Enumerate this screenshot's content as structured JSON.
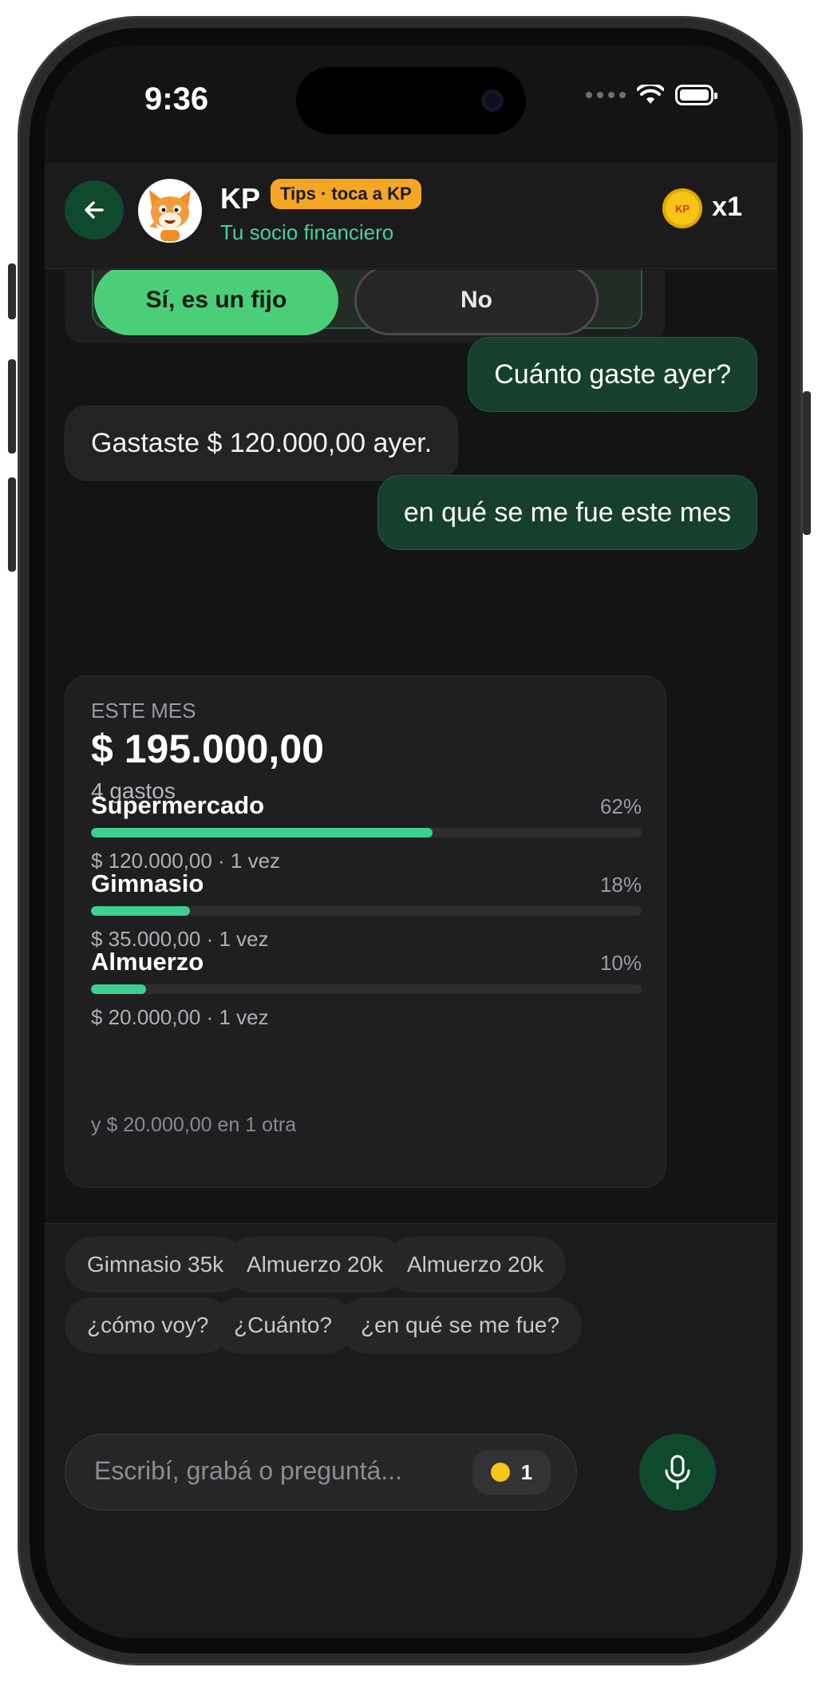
{
  "status_bar": {
    "time": "9:36"
  },
  "header": {
    "name": "KP",
    "tip_badge": "Tips · toca a KP",
    "subtitle": "Tu socio financiero",
    "coins": "x1",
    "coin_text": "KP"
  },
  "confirm": {
    "yes_label": "Sí, es un fijo",
    "no_label": "No"
  },
  "messages": [
    {
      "role": "user",
      "text": "Cuánto gaste ayer?"
    },
    {
      "role": "bot",
      "text": "Gastaste $ 120.000,00 ayer."
    },
    {
      "role": "user",
      "text": "en qué se me fue este mes"
    }
  ],
  "summary": {
    "label": "ESTE MES",
    "total": "$ 195.000,00",
    "count": "4 gastos",
    "categories": [
      {
        "name": "Supermercado",
        "pct": "62%",
        "fill": 0.62,
        "detail": "$ 120.000,00 · 1 vez"
      },
      {
        "name": "Gimnasio",
        "pct": "18%",
        "fill": 0.18,
        "detail": "$ 35.000,00 · 1 vez"
      },
      {
        "name": "Almuerzo",
        "pct": "10%",
        "fill": 0.1,
        "detail": "$ 20.000,00 · 1 vez"
      }
    ],
    "more": "y $ 20.000,00 en 1 otra"
  },
  "chips": [
    "Gimnasio 35k",
    "Almuerzo 20k",
    "Almuerzo 20k",
    "¿cómo voy?",
    "¿Cuánto?",
    "¿en qué se me fue?"
  ],
  "input": {
    "placeholder": "Escribí, grabá o preguntá...",
    "credits": "1"
  },
  "colors": {
    "accent": "#4cce78",
    "bar": "#3bd08f",
    "header_sub": "#4cd09a",
    "badge": "#f5a623"
  }
}
